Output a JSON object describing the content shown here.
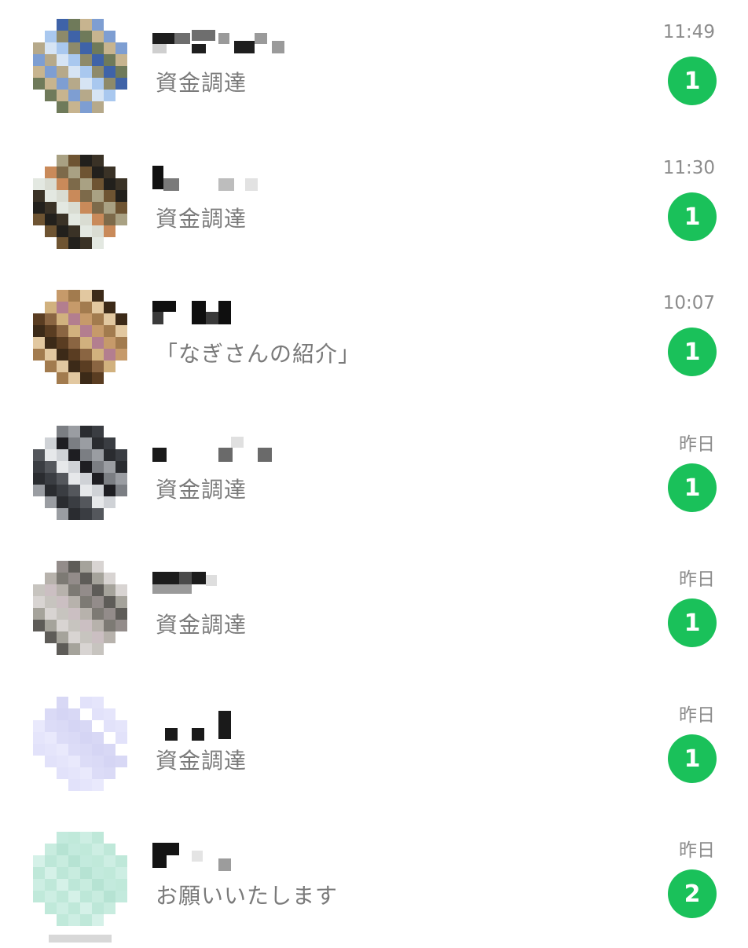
{
  "chats": [
    {
      "preview": "資金調達",
      "time": "11:49",
      "unread": "1",
      "avatar_palette": [
        "#a9c8ef",
        "#7e9ed2",
        "#3f63a8",
        "#d6e4f4",
        "#c7b48f",
        "#8e8a6a",
        "#b6a98a",
        "#6f7a5a"
      ],
      "name_palette": [
        "#1e1e1e",
        "#6e6e6e",
        "#9a9a9a",
        "#cfcfcf"
      ]
    },
    {
      "preview": "資金調達",
      "time": "11:30",
      "unread": "1",
      "avatar_palette": [
        "#6e5432",
        "#c98a5a",
        "#3a3226",
        "#a9a183",
        "#d9dcd2",
        "#22201c",
        "#7d6a4a",
        "#e3e8e1"
      ],
      "name_palette": [
        "#111111",
        "#7a7a7a",
        "#bdbdbd",
        "#e2e2e2"
      ]
    },
    {
      "preview": "「なぎさんの紹介」",
      "time": "10:07",
      "unread": "1",
      "avatar_palette": [
        "#5a3d22",
        "#a27b4e",
        "#d1b17e",
        "#3c2a18",
        "#c69a6a",
        "#8a6542",
        "#e2c8a0",
        "#b37e8f"
      ],
      "name_palette": [
        "#0f0f0f",
        "#3a3a3a",
        "#9e9e9e",
        "#e6e6e6"
      ]
    },
    {
      "preview": "資金調達",
      "time": "昨日",
      "unread": "1",
      "avatar_palette": [
        "#1e1e22",
        "#54575c",
        "#9a9da2",
        "#cfd2d6",
        "#3a3d42",
        "#7b7e83",
        "#e6e8ea",
        "#2a2c30"
      ],
      "name_palette": [
        "#1a1a1a",
        "#6a6a6a",
        "#a8a8a8",
        "#e0e0e0"
      ]
    },
    {
      "preview": "資金調達",
      "time": "昨日",
      "unread": "1",
      "avatar_palette": [
        "#a5a39b",
        "#7d7a74",
        "#c7c4bf",
        "#5e5c58",
        "#b7b2ac",
        "#d8d4d2",
        "#938c8a",
        "#cbbfc2"
      ],
      "name_palette": [
        "#1c1c1c",
        "#4a4a4a",
        "#9a9a9a",
        "#dedede"
      ]
    },
    {
      "preview": "資金調達",
      "time": "昨日",
      "unread": "1",
      "avatar_palette": [
        "#dcdcf7",
        "#e2e2fa",
        "#d5d5f4",
        "#e9e9fc",
        "#ffffff",
        "#dadaf6",
        "#e5e5fb",
        "#d8d8f5"
      ],
      "name_palette": [
        "#1a1a1a",
        "#2e2e2e",
        "#dcdcdc",
        "#f2f2f2"
      ]
    },
    {
      "preview": "お願いいたします",
      "time": "昨日",
      "unread": "2",
      "avatar_palette": [
        "#c3eadd",
        "#bde7d8",
        "#cdeee3",
        "#b6e3d3",
        "#d5f1e8",
        "#c0e9da",
        "#c8ecdf",
        "#bfe8d9"
      ],
      "name_palette": [
        "#141414",
        "#5a5a5a",
        "#9c9c9c",
        "#e4e4e4"
      ]
    }
  ],
  "colors": {
    "badge": "#1ac15a",
    "preview_text": "#7a7a7a",
    "timestamp_text": "#8c8c8c",
    "background": "#ffffff"
  }
}
